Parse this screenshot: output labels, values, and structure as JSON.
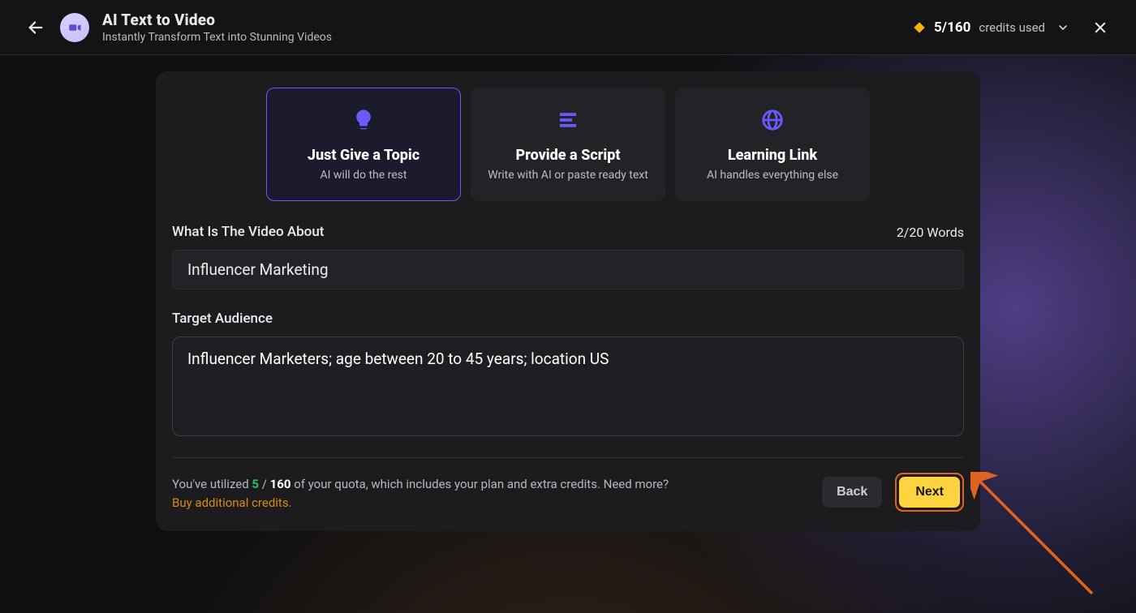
{
  "header": {
    "title": "AI Text to Video",
    "subtitle": "Instantly Transform Text into Stunning Videos"
  },
  "credits": {
    "used": "5",
    "sep": "/",
    "total": "160",
    "label": "credits used"
  },
  "options": [
    {
      "title": "Just Give a Topic",
      "subtitle": "AI will do the rest",
      "icon": "lightbulb-icon",
      "selected": true
    },
    {
      "title": "Provide a Script",
      "subtitle": "Write with AI or paste ready text",
      "icon": "script-lines-icon",
      "selected": false
    },
    {
      "title": "Learning Link",
      "subtitle": "AI handles everything else",
      "icon": "globe-icon",
      "selected": false
    }
  ],
  "topic": {
    "label": "What Is The Video About",
    "word_count": "2/20 Words",
    "value": "Influencer Marketing"
  },
  "audience": {
    "label": "Target Audience",
    "value": "Influencer Marketers; age between 20 to 45 years; location US"
  },
  "quota": {
    "prefix": "You've utilized ",
    "used": "5",
    "slash": " / ",
    "total": "160",
    "suffix": " of your quota, which includes your plan and extra credits. Need more?",
    "buy_link": "Buy additional credits."
  },
  "buttons": {
    "back": "Back",
    "next": "Next"
  }
}
